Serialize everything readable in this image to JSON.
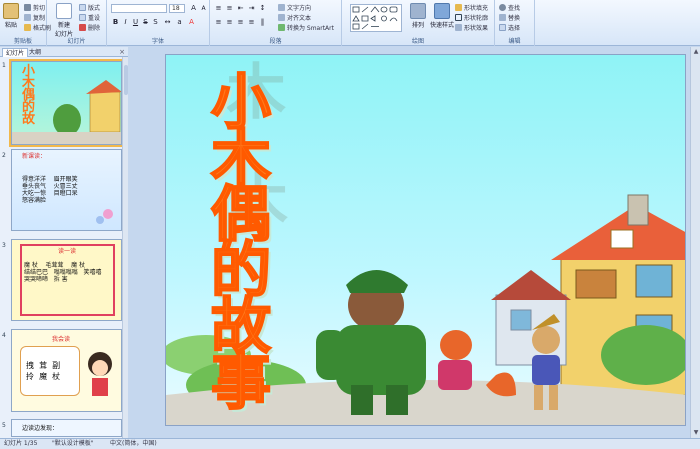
{
  "ribbon": {
    "clipboard": {
      "label": "剪贴板",
      "paste": "粘贴",
      "cut": "剪切",
      "copy": "复制",
      "format_painter": "格式刷"
    },
    "slides": {
      "label": "幻灯片",
      "new_slide": "新建\n幻灯片",
      "layout": "版式",
      "reset": "重设",
      "delete": "删除"
    },
    "font": {
      "label": "字体",
      "font_name": "",
      "font_size": "18"
    },
    "paragraph": {
      "label": "段落",
      "text_direction": "文字方向",
      "align_text": "对齐文本",
      "smartart": "转换为 SmartArt"
    },
    "drawing": {
      "label": "绘图",
      "arrange": "排列",
      "quick_styles": "快速样式",
      "shape_fill": "形状填充",
      "shape_outline": "形状轮廓",
      "shape_effects": "形状效果"
    },
    "editing": {
      "label": "编辑",
      "find": "查找",
      "replace": "替换",
      "select": "选择"
    }
  },
  "panel": {
    "tab_slides": "幻灯片",
    "tab_outline": "大纲",
    "close": "×",
    "thumbs": [
      {
        "num": "1",
        "text": ""
      },
      {
        "num": "2",
        "title": "新课读：",
        "text": "得意洋洋    眉开眼笑\n垂头丧气    火冒三丈\n大吃一惊    目瞪口呆\n怒容满脸"
      },
      {
        "num": "3",
        "title": "读一读",
        "text": "魔 杖    毛茸茸    魔 杖\n结结巴巴   嗡嗡嗡嗡   笑嘻嘻\n哭哭啼啼   拆 害"
      },
      {
        "num": "4",
        "title": "我会读",
        "text": "拽  茸  副\n拎  魔  杖"
      },
      {
        "num": "5",
        "text": "边读边发现："
      }
    ]
  },
  "slide": {
    "title_chars": [
      "小",
      "木",
      "偶",
      "的",
      "故",
      "事"
    ]
  },
  "status": {
    "slide_count": "幻灯片 1/35",
    "theme": "\"默认设计模板\"",
    "language": "中文(简体，中国)"
  },
  "colors": {
    "title_orange": "#ff7a1c",
    "slide_sky": "#8ff3f6",
    "ribbon_blue": "#d7e6f8"
  }
}
